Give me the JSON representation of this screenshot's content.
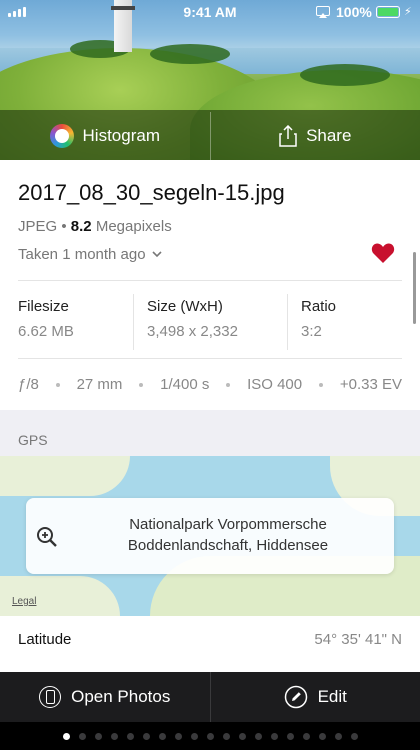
{
  "status_bar": {
    "time": "9:41 AM",
    "battery": "100%",
    "signal_icon": "signal-bars-icon",
    "airplay_icon": "airplay-icon",
    "battery_icon": "battery-icon",
    "charging_icon": "bolt-icon"
  },
  "top_actions": {
    "histogram_label": "Histogram",
    "share_label": "Share"
  },
  "photo": {
    "filename": "2017_08_30_segeln-15.jpg",
    "format": "JPEG",
    "megapixels_value": "8.2",
    "megapixels_unit": "Megapixels",
    "taken": "Taken 1 month ago",
    "favorite": true
  },
  "details": {
    "filesize_label": "Filesize",
    "filesize_value": "6.62 MB",
    "size_label": "Size (WxH)",
    "size_value": "3,498 x 2,332",
    "ratio_label": "Ratio",
    "ratio_value": "3:2"
  },
  "exif": {
    "aperture": "ƒ/8",
    "focal_length": "27 mm",
    "shutter": "1/400 s",
    "iso": "ISO 400",
    "exposure": "+0.33 EV"
  },
  "gps": {
    "section_title": "GPS",
    "place_line1": "Nationalpark Vorpommersche",
    "place_line2": "Boddenlandschaft, Hiddensee",
    "legal": "Legal",
    "latitude_label": "Latitude",
    "latitude_value": "54° 35' 41\" N"
  },
  "bottom_actions": {
    "open_photos_label": "Open Photos",
    "edit_label": "Edit"
  },
  "page_indicator": {
    "count": 19,
    "active": 0
  },
  "colors": {
    "heart": "#c8102e",
    "battery": "#4cd964",
    "bottom_bar": "#1c1c1e"
  }
}
